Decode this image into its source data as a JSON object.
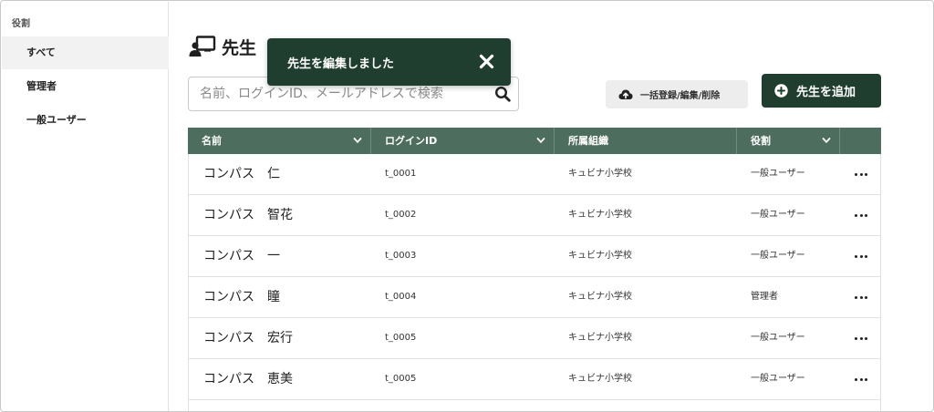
{
  "sidebar": {
    "heading": "役割",
    "items": [
      {
        "label": "すべて",
        "active": true
      },
      {
        "label": "管理者",
        "active": false
      },
      {
        "label": "一般ユーザー",
        "active": false
      }
    ]
  },
  "page": {
    "title": "先生",
    "title_icon": "teacher-board-icon"
  },
  "search": {
    "placeholder": "名前、ログインID、メールアドレスで検索",
    "value": ""
  },
  "toolbar": {
    "bulk_label": "一括登録/編集/削除",
    "bulk_icon": "cloud-upload-icon",
    "add_label": "先生を追加",
    "add_icon": "plus-circle-icon"
  },
  "toast": {
    "message": "先生を編集しました",
    "close_icon": "close-icon"
  },
  "table": {
    "columns": [
      "名前",
      "ログインID",
      "所属組織",
      "役割"
    ],
    "rows": [
      {
        "name": "コンパス　仁",
        "login_id": "t_0001",
        "org": "キュビナ小学校",
        "role": "一般ユーザー"
      },
      {
        "name": "コンパス　智花",
        "login_id": "t_0002",
        "org": "キュビナ小学校",
        "role": "一般ユーザー"
      },
      {
        "name": "コンパス　一",
        "login_id": "t_0003",
        "org": "キュビナ小学校",
        "role": "一般ユーザー"
      },
      {
        "name": "コンパス　瞳",
        "login_id": "t_0004",
        "org": "キュビナ小学校",
        "role": "管理者"
      },
      {
        "name": "コンパス　宏行",
        "login_id": "t_0005",
        "org": "キュビナ小学校",
        "role": "一般ユーザー"
      },
      {
        "name": "コンパス　恵美",
        "login_id": "t_0005",
        "org": "キュビナ小学校",
        "role": "一般ユーザー"
      }
    ]
  },
  "colors": {
    "primary_dark": "#1f3e30",
    "table_header": "#4d6e5e",
    "sidebar_active": "#f1f2f1",
    "bulk_button_bg": "#ededed"
  }
}
